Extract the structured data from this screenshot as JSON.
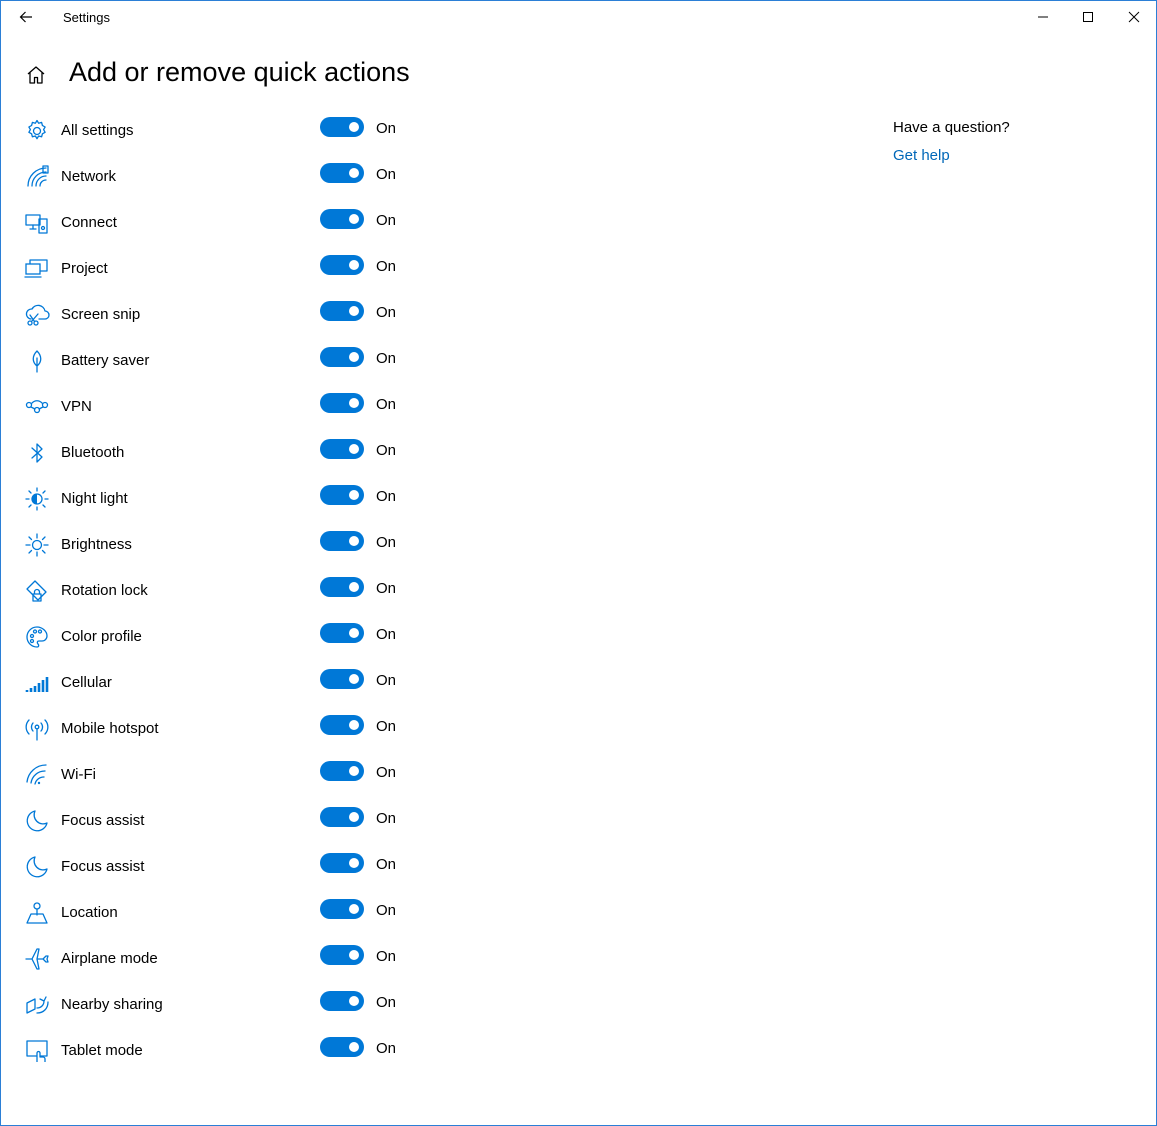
{
  "window": {
    "app_title": "Settings",
    "accent_color": "#0078d7",
    "border_color": "#2b7fd6"
  },
  "header": {
    "page_title": "Add or remove quick actions"
  },
  "help": {
    "question": "Have a question?",
    "link_label": "Get help",
    "link_color": "#0067b8"
  },
  "items": [
    {
      "label": "All settings",
      "state": "On",
      "icon": "gear-icon"
    },
    {
      "label": "Network",
      "state": "On",
      "icon": "network-icon"
    },
    {
      "label": "Connect",
      "state": "On",
      "icon": "connect-icon"
    },
    {
      "label": "Project",
      "state": "On",
      "icon": "project-icon"
    },
    {
      "label": "Screen snip",
      "state": "On",
      "icon": "screen-snip-icon"
    },
    {
      "label": "Battery saver",
      "state": "On",
      "icon": "battery-saver-icon"
    },
    {
      "label": "VPN",
      "state": "On",
      "icon": "vpn-icon"
    },
    {
      "label": "Bluetooth",
      "state": "On",
      "icon": "bluetooth-icon"
    },
    {
      "label": "Night light",
      "state": "On",
      "icon": "night-light-icon"
    },
    {
      "label": "Brightness",
      "state": "On",
      "icon": "brightness-icon"
    },
    {
      "label": "Rotation lock",
      "state": "On",
      "icon": "rotation-lock-icon"
    },
    {
      "label": "Color profile",
      "state": "On",
      "icon": "color-profile-icon"
    },
    {
      "label": "Cellular",
      "state": "On",
      "icon": "cellular-icon"
    },
    {
      "label": "Mobile hotspot",
      "state": "On",
      "icon": "mobile-hotspot-icon"
    },
    {
      "label": "Wi-Fi",
      "state": "On",
      "icon": "wifi-icon"
    },
    {
      "label": "Focus assist",
      "state": "On",
      "icon": "focus-assist-icon"
    },
    {
      "label": "Focus assist",
      "state": "On",
      "icon": "focus-assist-icon"
    },
    {
      "label": "Location",
      "state": "On",
      "icon": "location-icon"
    },
    {
      "label": "Airplane mode",
      "state": "On",
      "icon": "airplane-icon"
    },
    {
      "label": "Nearby sharing",
      "state": "On",
      "icon": "nearby-sharing-icon"
    },
    {
      "label": "Tablet mode",
      "state": "On",
      "icon": "tablet-mode-icon"
    }
  ]
}
